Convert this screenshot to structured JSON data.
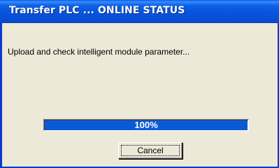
{
  "window": {
    "title": "Transfer PLC ... ONLINE STATUS"
  },
  "dialog": {
    "message": "Upload and check intelligent module parameter...",
    "progress": {
      "value_percent": 100,
      "label": "100%"
    },
    "cancel_label": "Cancel"
  },
  "colors": {
    "titlebar": "#0854dc",
    "progress_fill": "#0a5ad6",
    "background": "#ece9d8"
  }
}
